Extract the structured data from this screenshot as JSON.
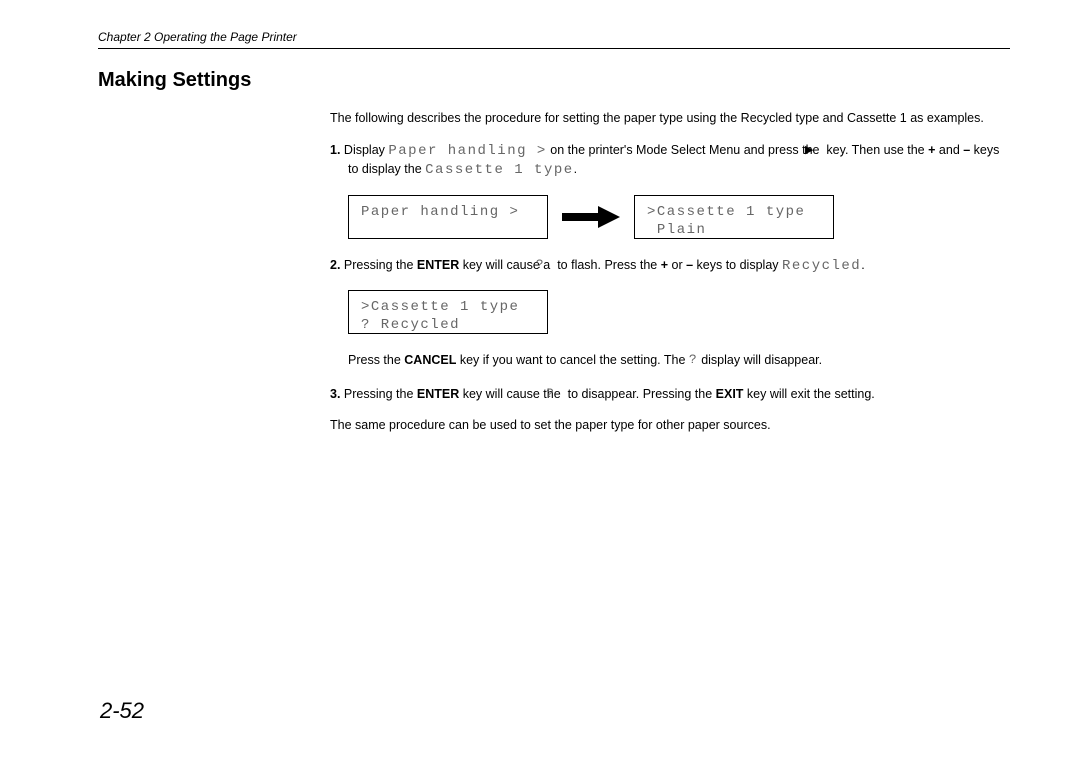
{
  "header": "Chapter 2  Operating the Page Printer",
  "section_title": "Making Settings",
  "intro": "The following describes the procedure for setting the paper type using the Recycled type and Cassette 1 as examples.",
  "step1": {
    "num": "1.",
    "pre": " Display ",
    "lcd": "Paper handling >",
    "mid": " on the printer's Mode Select Menu and press the ",
    "tri": "▶",
    "post1": " key. Then use the ",
    "plus": "+",
    "and": " and ",
    "minus": "–",
    "post2": " keys to display the ",
    "lcd2": "Cassette 1 type",
    "dot": "."
  },
  "display1": {
    "box1_line1": "Paper handling >",
    "box1_line2": "",
    "box2_line1": ">Cassette 1 type",
    "box2_line2": " Plain"
  },
  "step2": {
    "num": "2.",
    "pre": " Pressing the ",
    "enter": "ENTER",
    "mid1": " key will cause a ",
    "q": "?",
    "mid2": " to flash. Press the ",
    "plus": "+",
    "or": " or ",
    "minus": "–",
    "mid3": " keys to display ",
    "lcd": "Recycled",
    "dot": "."
  },
  "display2": {
    "line1": ">Cassette 1 type",
    "line2": "? Recycled"
  },
  "note": {
    "pre": "Press the ",
    "cancel": "CANCEL",
    "mid": " key if you want to cancel the setting. The ",
    "q": "?",
    "post": " display will disappear."
  },
  "step3": {
    "num": "3.",
    "pre": " Pressing the ",
    "enter": "ENTER",
    "mid1": " key will cause the ",
    "q": "?",
    "mid2": " to disappear. Pressing the ",
    "exit": "EXIT",
    "post": " key will exit the setting."
  },
  "closing": "The same procedure can be used to set the paper type for other paper sources.",
  "page_number": "2-52"
}
